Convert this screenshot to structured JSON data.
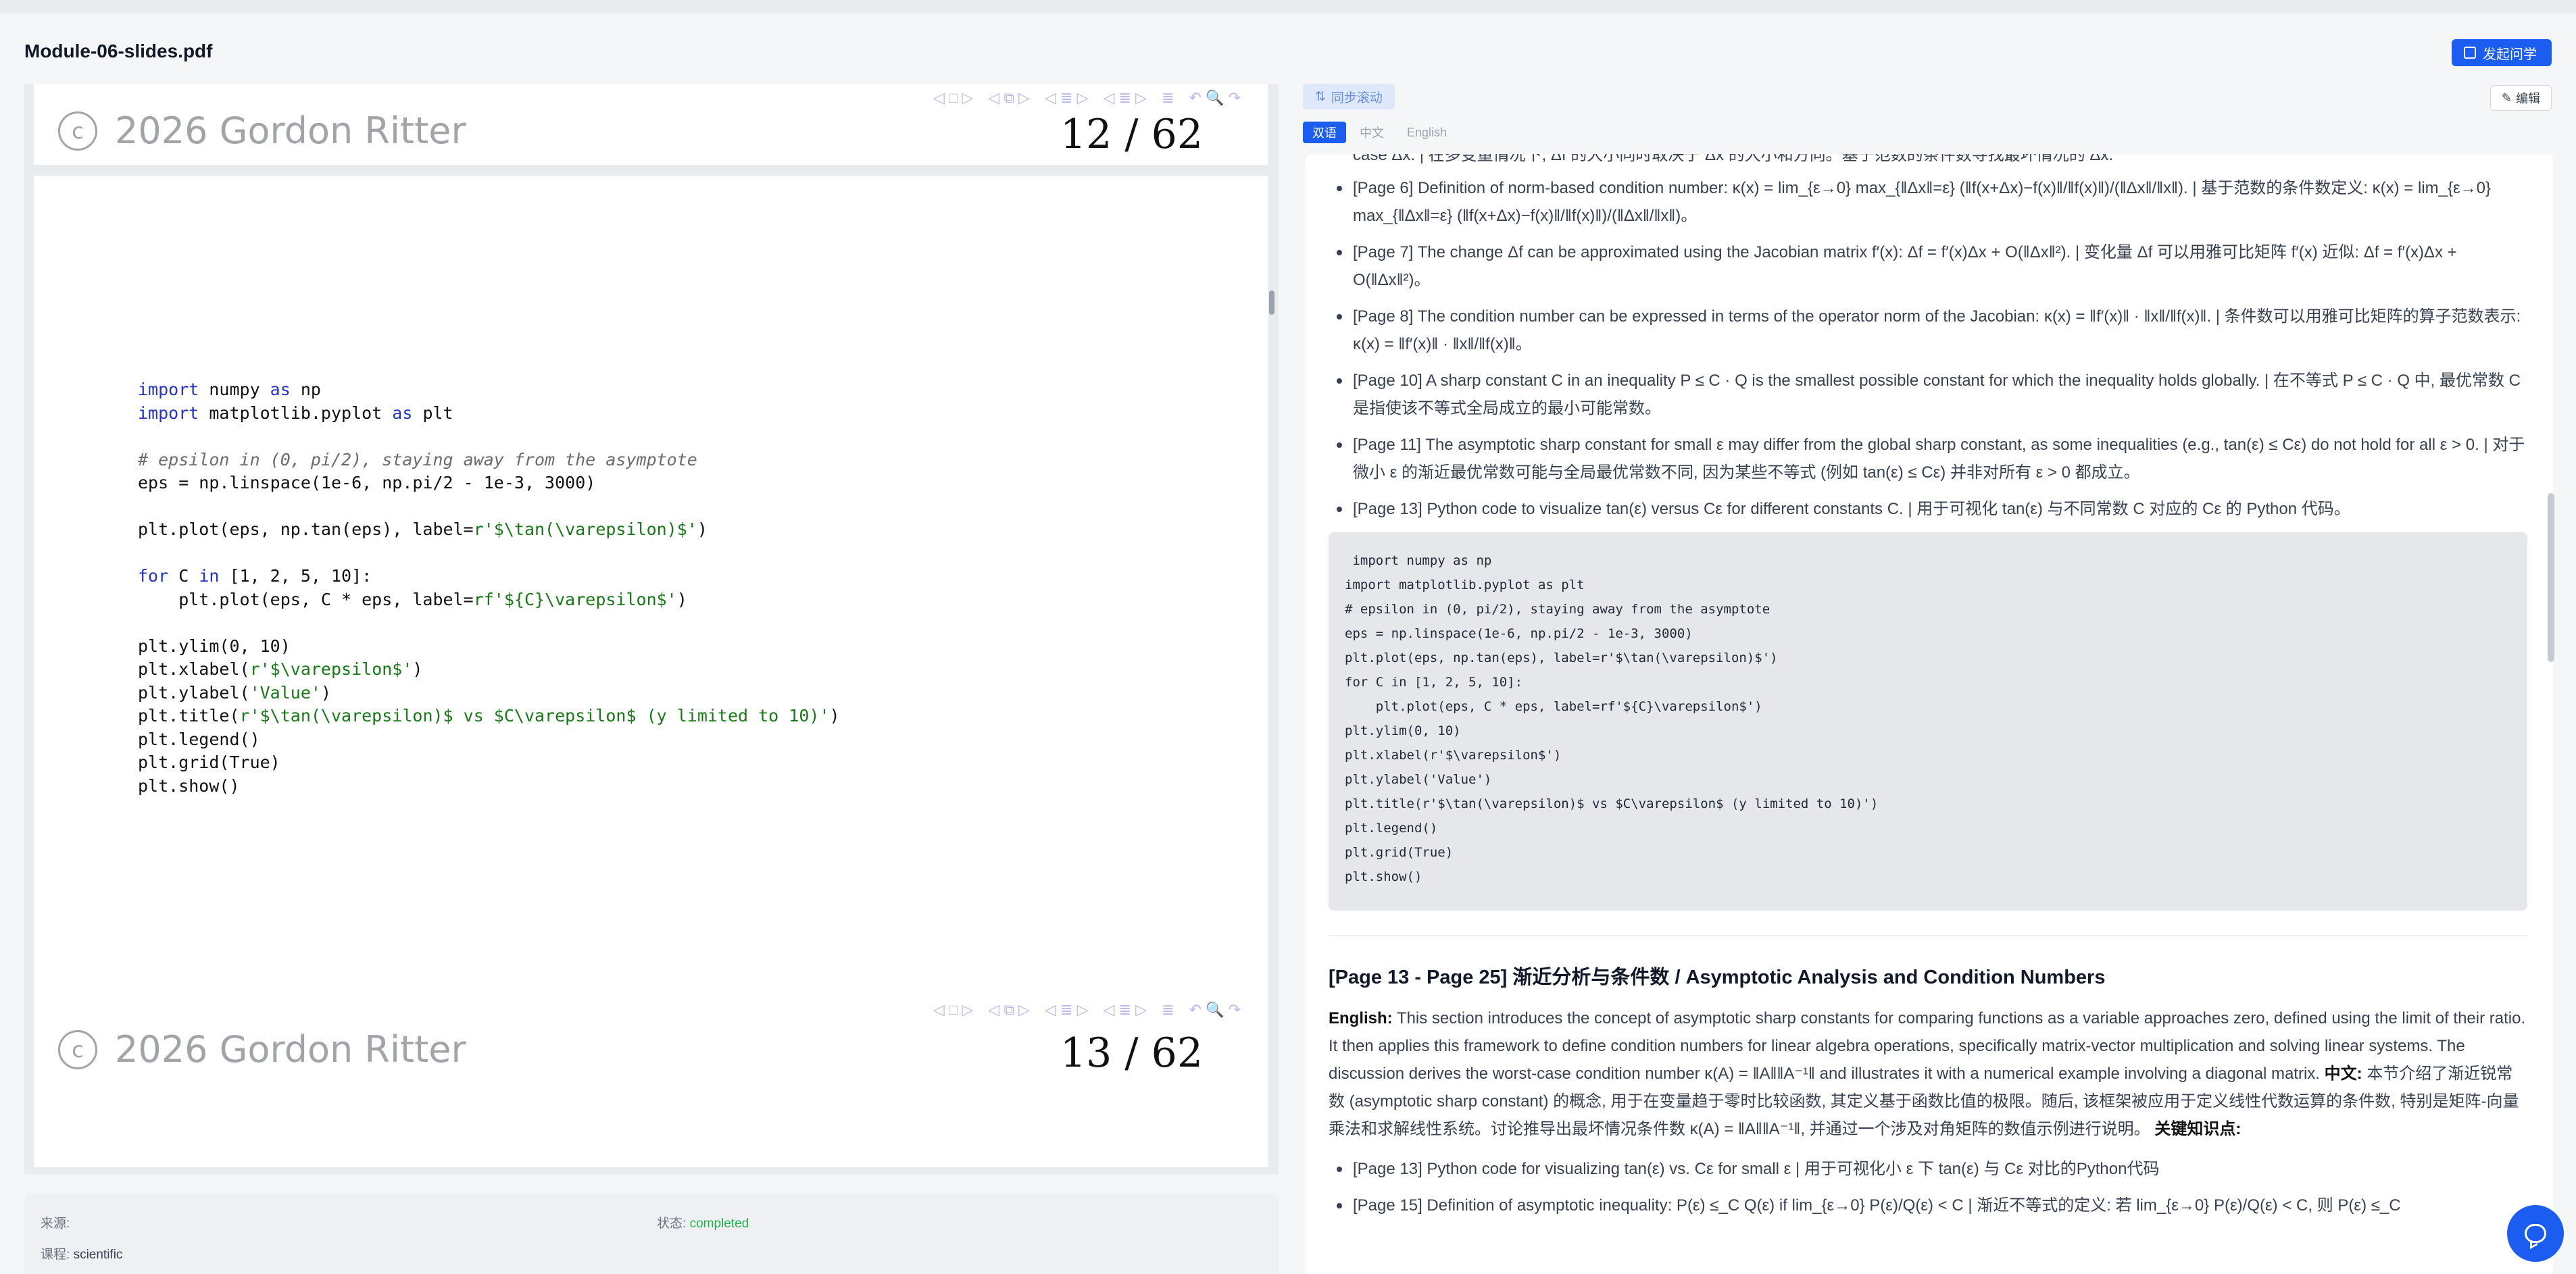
{
  "header": {
    "title": "Module-06-slides.pdf",
    "ask_button": "发起问学"
  },
  "viewer": {
    "nav_glyphs": [
      "◁ □ ▷",
      "◁ ⧉ ▷",
      "◁ ≣ ▷",
      "◁ ≣ ▷",
      "≣",
      "↶ 🔍 ↷"
    ],
    "copyright_symbol": "c",
    "copyright_text": "2026 Gordon Ritter",
    "page_a": "12 / 62",
    "page_b": "13 / 62",
    "code_lines": [
      "import numpy as np",
      "import matplotlib.pyplot as plt",
      "",
      "# epsilon in (0, pi/2), staying away from the asymptote",
      "eps = np.linspace(1e-6, np.pi/2 - 1e-3, 3000)",
      "",
      "plt.plot(eps, np.tan(eps), label=r'$\\tan(\\varepsilon)$')",
      "",
      "for C in [1, 2, 5, 10]:",
      "    plt.plot(eps, C * eps, label=rf'${C}\\varepsilon$')",
      "",
      "plt.ylim(0, 10)",
      "plt.xlabel(r'$\\varepsilon$')",
      "plt.ylabel('Value')",
      "plt.title(r'$\\tan(\\varepsilon)$ vs $C\\varepsilon$ (y limited to 10)')",
      "plt.legend()",
      "plt.grid(True)",
      "plt.show()"
    ]
  },
  "meta": {
    "source_label": "来源:",
    "status_label": "状态:",
    "status_value": "completed",
    "course_label": "课程:",
    "course_value": "scientific"
  },
  "right": {
    "sync_label": "同步滚动",
    "edit_label": "编辑",
    "tabs": [
      "双语",
      "中文",
      "English"
    ],
    "cut_line": "case Δx. | 在多变量情况下, Δf 的大小同时取决于 Δx 的大小和方向。基于范数的条件数寻找最坏情况的 Δx.",
    "bullets": [
      "[Page 6] Definition of norm-based condition number: κ(x) = lim_{ε→0} max_{‖Δx‖=ε} (‖f(x+Δx)−f(x)‖/‖f(x)‖)/(‖Δx‖/‖x‖). | 基于范数的条件数定义: κ(x) = lim_{ε→0} max_{‖Δx‖=ε} (‖f(x+Δx)−f(x)‖/‖f(x)‖)/(‖Δx‖/‖x‖)。",
      "[Page 7] The change Δf can be approximated using the Jacobian matrix f′(x): Δf = f′(x)Δx + O(‖Δx‖²). | 变化量 Δf 可以用雅可比矩阵 f′(x) 近似: Δf = f′(x)Δx + O(‖Δx‖²)。",
      "[Page 8] The condition number can be expressed in terms of the operator norm of the Jacobian: κ(x) = ‖f′(x)‖ · ‖x‖/‖f(x)‖. | 条件数可以用雅可比矩阵的算子范数表示: κ(x) = ‖f′(x)‖ · ‖x‖/‖f(x)‖。",
      "[Page 10] A sharp constant C in an inequality P ≤ C · Q is the smallest possible constant for which the inequality holds globally. | 在不等式 P ≤ C · Q 中, 最优常数 C 是指使该不等式全局成立的最小可能常数。",
      "[Page 11] The asymptotic sharp constant for small ε may differ from the global sharp constant, as some inequalities (e.g., tan(ε) ≤ Cε) do not hold for all ε > 0. | 对于微小 ε 的渐近最优常数可能与全局最优常数不同, 因为某些不等式 (例如 tan(ε) ≤ Cε) 并非对所有 ε > 0 都成立。",
      "[Page 13] Python code to visualize tan(ε) versus Cε for different constants C. | 用于可视化 tan(ε) 与不同常数 C 对应的 Cε 的 Python 代码。"
    ],
    "code_lines": [
      " import numpy as np",
      "import matplotlib.pyplot as plt",
      "# epsilon in (0, pi/2), staying away from the asymptote",
      "eps = np.linspace(1e-6, np.pi/2 - 1e-3, 3000)",
      "plt.plot(eps, np.tan(eps), label=r'$\\tan(\\varepsilon)$')",
      "for C in [1, 2, 5, 10]:",
      "    plt.plot(eps, C * eps, label=rf'${C}\\varepsilon$')",
      "plt.ylim(0, 10)",
      "plt.xlabel(r'$\\varepsilon$')",
      "plt.ylabel('Value')",
      "plt.title(r'$\\tan(\\varepsilon)$ vs $C\\varepsilon$ (y limited to 10)')",
      "plt.legend()",
      "plt.grid(True)",
      "plt.show()"
    ],
    "section_title": "[Page 13 - Page 25] 渐近分析与条件数 / Asymptotic Analysis and Condition Numbers",
    "english_label": "English:",
    "english_text": "This section introduces the concept of asymptotic sharp constants for comparing functions as a variable approaches zero, defined using the limit of their ratio. It then applies this framework to define condition numbers for linear algebra operations, specifically matrix-vector multiplication and solving linear systems. The discussion derives the worst-case condition number κ(A) = ‖A‖‖A⁻¹‖ and illustrates it with a numerical example involving a diagonal matrix.",
    "chinese_label": "中文:",
    "chinese_text": "本节介绍了渐近锐常数 (asymptotic sharp constant) 的概念, 用于在变量趋于零时比较函数, 其定义基于函数比值的极限。随后, 该框架被应用于定义线性代数运算的条件数, 特别是矩阵-向量乘法和求解线性系统。讨论推导出最坏情况条件数 κ(A) = ‖A‖‖A⁻¹‖, 并通过一个涉及对角矩阵的数值示例进行说明。",
    "key_label": "关键知识点:",
    "bullets2": [
      "[Page 13] Python code for visualizing tan(ε) vs. Cε for small ε | 用于可视化小 ε 下 tan(ε) 与 Cε 对比的Python代码",
      "[Page 15] Definition of asymptotic inequality: P(ε) ≤_C Q(ε) if lim_{ε→0} P(ε)/Q(ε) < C | 渐近不等式的定义: 若 lim_{ε→0} P(ε)/Q(ε) < C, 则 P(ε) ≤_C"
    ]
  },
  "colors": {
    "accent": "#1a5df0",
    "status_ok": "#22b34a"
  }
}
